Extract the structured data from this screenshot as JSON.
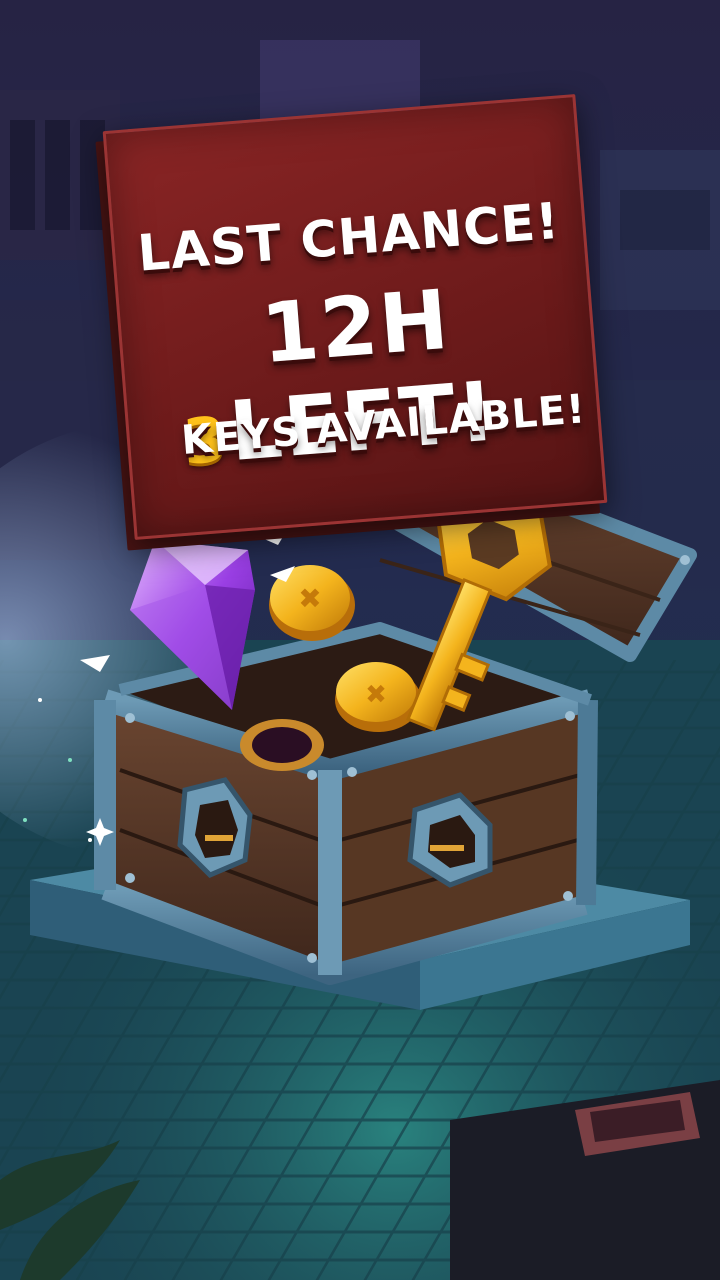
{
  "banner": {
    "line1": "LAST CHANCE!",
    "line2": "12H LEFT!",
    "keys_count": "3",
    "keys_text": "KEYS AVAILABLE!"
  },
  "colors": {
    "banner_red": "#7a1e1e",
    "key_gold": "#f2b21c",
    "gem_purple": "#9b3fe0",
    "chest_frame": "#5d8aa6",
    "floor_teal": "#2f7f86"
  },
  "icons": [
    "treasure-chest-icon",
    "purple-gem-icon",
    "gold-key-icon",
    "gold-coin-icon"
  ]
}
